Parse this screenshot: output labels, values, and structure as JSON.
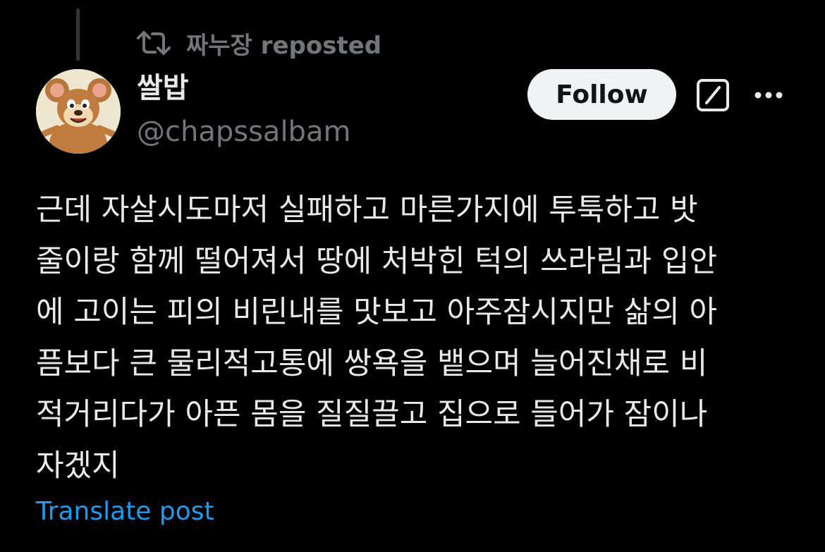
{
  "repost": {
    "icon": "repost-icon",
    "text": "짜누장 reposted"
  },
  "author": {
    "avatar_icon": "avatar-cartoon-mouse",
    "display_name": "쌀밥",
    "handle": "@chapssalbam"
  },
  "actions": {
    "follow_label": "Follow",
    "edit_icon": "edit-icon",
    "more_icon": "more-icon"
  },
  "post": {
    "lines": [
      "근데 자살시도마저 실패하고 마른가지에 투툭하고 밧",
      "줄이랑 함께 떨어져서 땅에 처박힌 턱의 쓰라림과 입안",
      "에 고이는 피의 비린내를 맛보고 아주잠시지만 삶의 아",
      "픔보다 큰 물리적고통에 쌍욕을 뱉으며 늘어진채로 비",
      "적거리다가 아픈 몸을 질질끌고 집으로 들어가 잠이나",
      "자겠지"
    ],
    "translate_label": "Translate post"
  },
  "colors": {
    "background": "#000000",
    "text_primary": "#e7e9ea",
    "text_secondary": "#71767b",
    "link": "#1d9bf0",
    "follow_bg": "#eff3f4"
  }
}
